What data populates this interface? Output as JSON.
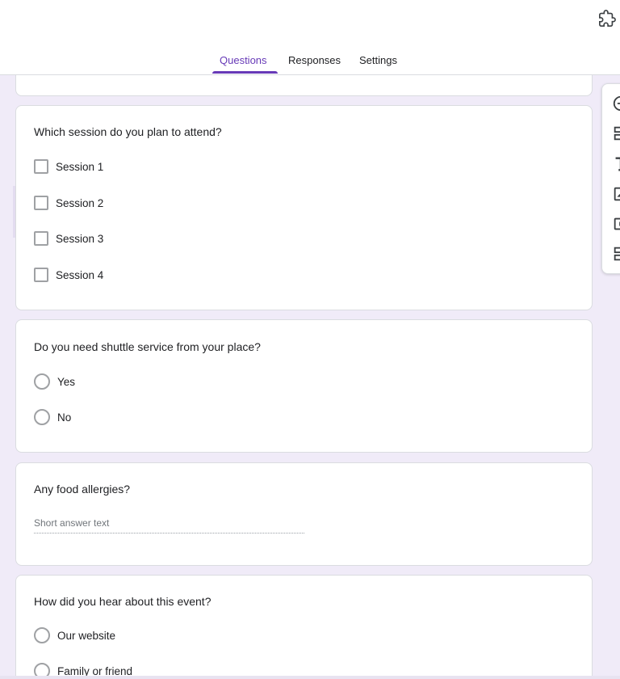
{
  "header": {
    "addon_icon": "puzzle-icon",
    "tabs": [
      {
        "label": "Questions",
        "active": true
      },
      {
        "label": "Responses",
        "active": false
      },
      {
        "label": "Settings",
        "active": false
      }
    ]
  },
  "questions": [
    {
      "title": "Which session do you plan to attend?",
      "type": "checkbox",
      "options": [
        "Session 1",
        "Session 2",
        "Session 3",
        "Session 4"
      ]
    },
    {
      "title": "Do you need shuttle service from your place?",
      "type": "radio",
      "options": [
        "Yes",
        "No"
      ]
    },
    {
      "title": "Any food allergies?",
      "type": "short-answer",
      "placeholder": "Short answer text"
    },
    {
      "title": "How did you hear about this event?",
      "type": "radio",
      "options": [
        "Our website",
        "Family or friend"
      ]
    }
  ],
  "side_toolbar": {
    "tools": [
      "add-question-icon",
      "import-questions-icon",
      "add-title-icon",
      "add-image-icon",
      "add-video-icon",
      "add-section-icon"
    ]
  },
  "colors": {
    "accent": "#673ab7",
    "background": "#f0ebf8",
    "card": "#ffffff"
  }
}
